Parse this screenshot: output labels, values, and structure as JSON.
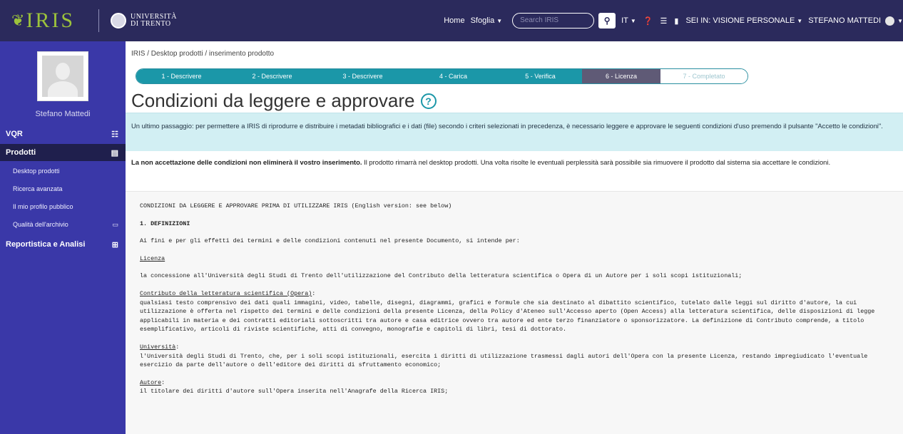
{
  "topbar": {
    "brand": "IRIS",
    "university_line1": "UNIVERSITÀ",
    "university_line2": "DI TRENTO",
    "home": "Home",
    "browse": "Sfoglia",
    "search_placeholder": "Search IRIS",
    "language": "IT",
    "role": "SEI IN: VISIONE PERSONALE",
    "user": "STEFANO MATTEDI"
  },
  "sidebar": {
    "profile_name": "Stefano Mattedi",
    "sections": [
      {
        "label": "VQR"
      },
      {
        "label": "Prodotti"
      },
      {
        "label": "Reportistica e Analisi"
      }
    ],
    "items": [
      {
        "label": "Desktop prodotti"
      },
      {
        "label": "Ricerca avanzata"
      },
      {
        "label": "Il mio profilo pubblico"
      },
      {
        "label": "Qualità dell'archivio"
      }
    ]
  },
  "breadcrumb": "IRIS / Desktop prodotti / inserimento prodotto",
  "wizard": {
    "steps": [
      {
        "label": "1 - Descrivere"
      },
      {
        "label": "2 - Descrivere"
      },
      {
        "label": "3 - Descrivere"
      },
      {
        "label": "4 - Carica"
      },
      {
        "label": "5 - Verifica"
      },
      {
        "label": "6 - Licenza"
      },
      {
        "label": "7 - Completato"
      }
    ]
  },
  "page_title": "Condizioni da leggere e approvare",
  "info_text": "Un ultimo passaggio: per permettere a IRIS di riprodurre e distribuire i metadati bibliografici e i dati (file) secondo i criteri selezionati in precedenza, è necessario leggere e approvare le seguenti condizioni d'uso premendo il pulsante \"Accetto le condizioni\".",
  "notice_bold": "La non accettazione delle condizioni non eliminerà il vostro inserimento.",
  "notice_rest": " Il prodotto rimarrà nel desktop prodotti. Una volta risolte le eventuali perplessità sarà possibile sia rimuovere il prodotto dal sistema sia accettare le condizioni.",
  "document": {
    "heading": "CONDIZIONI DA LEGGERE E APPROVARE PRIMA DI UTILIZZARE IRIS (English version: see below)",
    "section1": "1. DEFINIZIONI",
    "intro": "Ai fini e per gli effetti dei termini e delle condizioni contenuti nel presente Documento, si intende per:",
    "def_licenza_term": "Licenza",
    "def_licenza_text": "la concessione all'Università degli Studi di Trento dell'utilizzazione del Contributo della letteratura scientifica o Opera di un Autore per i soli scopi istituzionali;",
    "def_opera_term": "Contributo della letteratura scientifica (Opera)",
    "def_opera_colon": ":",
    "def_opera_text": "qualsiasi testo comprensivo dei dati quali immagini, video, tabelle, disegni, diagrammi, grafici e formule che sia destinato al dibattito scientifico, tutelato dalle leggi sul diritto d'autore, la cui utilizzazione è offerta nel rispetto dei termini e delle condizioni della presente Licenza, della Policy d'Ateneo sull'Accesso aperto (Open Access) alla letteratura scientifica, delle disposizioni di legge applicabili in materia e dei contratti editoriali sottoscritti tra autore e casa editrice ovvero tra autore ed ente terzo finanziatore o sponsorizzatore. La definizione di Contributo comprende, a titolo esemplificativo, articoli di riviste scientifiche, atti di convegno, monografie e capitoli di libri, tesi di dottorato.",
    "def_univ_term": "Università",
    "def_univ_colon": ":",
    "def_univ_text": "l'Università degli Studi di Trento, che, per i soli scopi istituzionali, esercita i diritti di utilizzazione trasmessi dagli autori dell'Opera con la presente Licenza, restando impregiudicato l'eventuale esercizio da parte dell'autore o dell'editore dei diritti di sfruttamento economico;",
    "def_autore_term": "Autore",
    "def_autore_colon": ":",
    "def_autore_text": "il titolare dei diritti d'autore sull'Opera inserita nell'Anagrafe della Ricerca IRIS;"
  }
}
